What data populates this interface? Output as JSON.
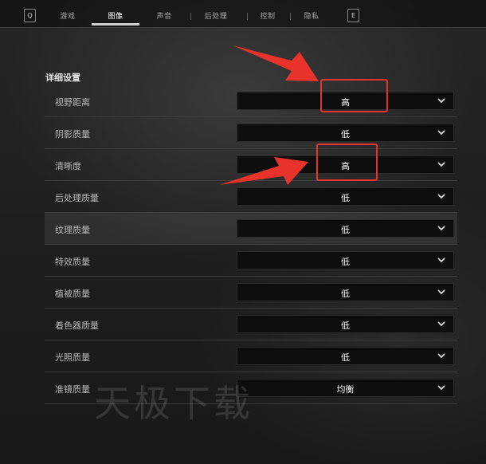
{
  "topbar": {
    "left_key": "Q",
    "right_key": "E",
    "tabs": [
      {
        "label": "游戏"
      },
      {
        "label": "图像"
      },
      {
        "label": "声音"
      },
      {
        "label": "后处理"
      },
      {
        "label": "控制"
      },
      {
        "label": "隐私"
      }
    ],
    "active_tab": "图像"
  },
  "section": {
    "title": "详细设置",
    "rows": [
      {
        "label": "视野距离",
        "value": "高"
      },
      {
        "label": "阴影质量",
        "value": "低"
      },
      {
        "label": "清晰度",
        "value": "高"
      },
      {
        "label": "后处理质量",
        "value": "低"
      },
      {
        "label": "纹理质量",
        "value": "低"
      },
      {
        "label": "特效质量",
        "value": "低"
      },
      {
        "label": "植被质量",
        "value": "低"
      },
      {
        "label": "着色器质量",
        "value": "低"
      },
      {
        "label": "光照质量",
        "value": "低"
      },
      {
        "label": "准镜质量",
        "value": "均衡"
      }
    ]
  },
  "watermark": "天极下载",
  "colors": {
    "annotation": "#e8332a",
    "accent": "#cfcfcf"
  }
}
